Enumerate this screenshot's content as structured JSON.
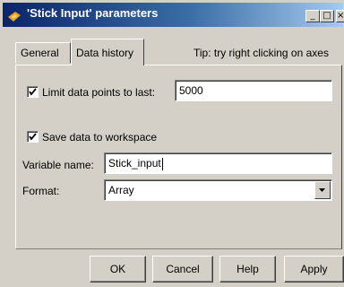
{
  "window": {
    "title": "'Stick Input' parameters",
    "controls": {
      "minimize": "_",
      "maximize": "□",
      "close": "×"
    }
  },
  "tabs": [
    {
      "label": "General",
      "selected": false
    },
    {
      "label": "Data history",
      "selected": true
    }
  ],
  "tip": "Tip: try right clicking on axes",
  "limit": {
    "label": "Limit data points to last:",
    "checked": true,
    "value": "5000"
  },
  "save": {
    "label": "Save data to workspace",
    "checked": true
  },
  "variable": {
    "label": "Variable name:",
    "value": "Stick_input"
  },
  "format": {
    "label": "Format:",
    "value": "Array"
  },
  "buttons": {
    "ok": "OK",
    "cancel": "Cancel",
    "help": "Help",
    "apply": "Apply"
  },
  "colors": {
    "title_bar_start": "#0a246a",
    "title_bar_end": "#a6caf0",
    "face": "#d4d0c8"
  }
}
